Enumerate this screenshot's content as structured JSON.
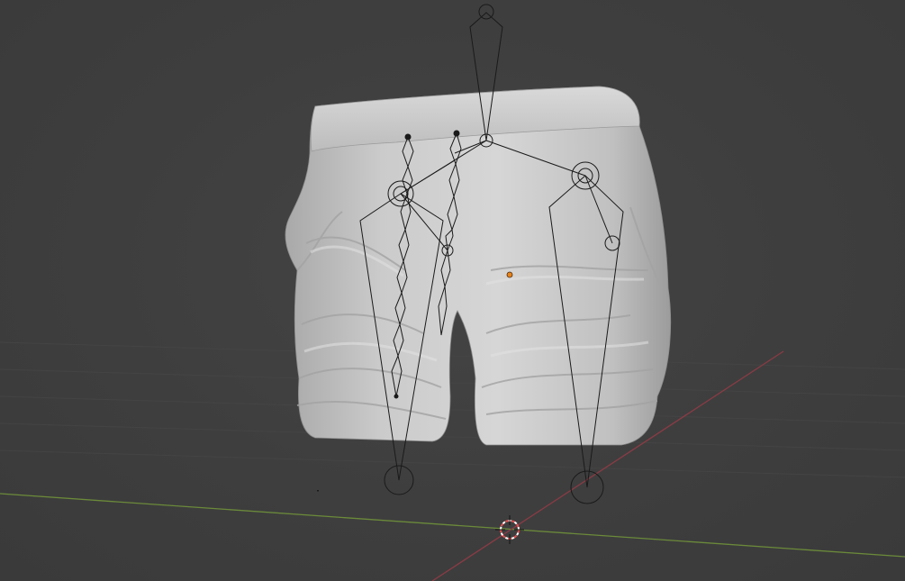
{
  "viewport": {
    "mode": "3D Viewport",
    "background_color": "#3d3d3d",
    "grid_color": "#474747"
  },
  "axes": {
    "x_axis_color": "#8a3b45",
    "y_axis_color": "#6b8a3a"
  },
  "scene": {
    "mesh_object": "shorts-mesh",
    "mesh_color": "#cfcfcf",
    "armature_object": "armature",
    "armature_wire_color": "#1a1a1a",
    "origin_dot_color": "#e8841a",
    "cursor": "3d-cursor-icon"
  }
}
